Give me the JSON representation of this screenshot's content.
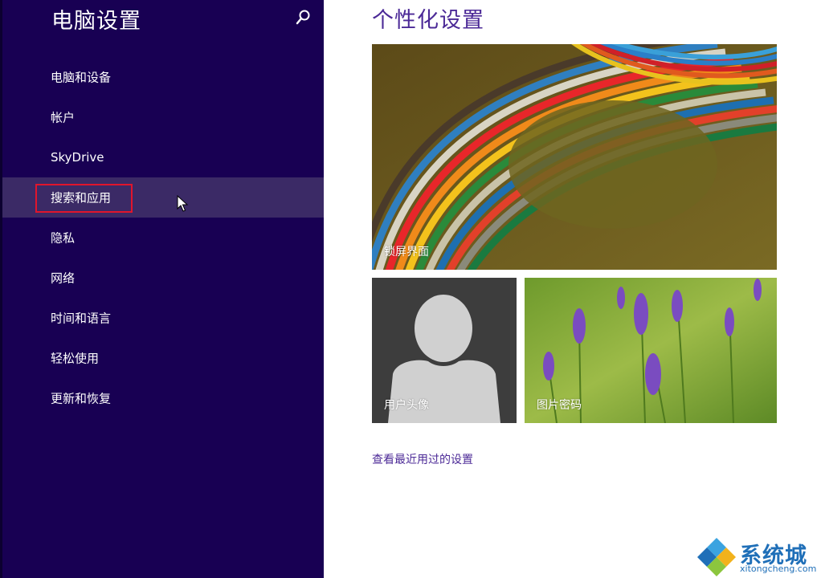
{
  "sidebar": {
    "title": "电脑设置",
    "items": [
      {
        "label": "电脑和设备"
      },
      {
        "label": "帐户"
      },
      {
        "label": "SkyDrive"
      },
      {
        "label": "搜索和应用",
        "selected": true
      },
      {
        "label": "隐私"
      },
      {
        "label": "网络"
      },
      {
        "label": "时间和语言"
      },
      {
        "label": "轻松使用"
      },
      {
        "label": "更新和恢复"
      }
    ]
  },
  "main": {
    "title": "个性化设置",
    "tiles": {
      "lock_screen": "锁屏界面",
      "account_picture": "用户头像",
      "picture_password": "图片密码"
    },
    "recent_link": "查看最近用过的设置"
  },
  "watermark": {
    "name": "系统城",
    "url": "xitongcheng.com"
  },
  "colors": {
    "sidebar_bg": "#180053",
    "selected_bg": "#3b2a66",
    "accent": "#4c2a97",
    "highlight": "#e0152c"
  }
}
